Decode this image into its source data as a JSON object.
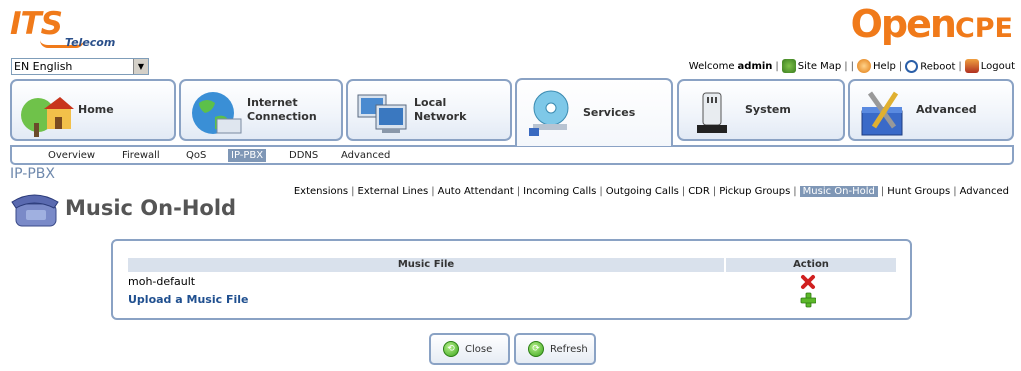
{
  "header": {
    "brand_its": "ITS",
    "brand_telecom": "Telecom",
    "brand_open": "Open",
    "brand_cpe": "CPE"
  },
  "language": {
    "selected": "EN English"
  },
  "top_links": {
    "welcome_prefix": "Welcome",
    "user": "admin",
    "site_map": "Site Map",
    "help": "Help",
    "reboot": "Reboot",
    "logout": "Logout"
  },
  "main_tabs": [
    {
      "label": "Home",
      "icon": "home-icon"
    },
    {
      "label": "Internet\nConnection",
      "icon": "globe-icon"
    },
    {
      "label": "Local\nNetwork",
      "icon": "computers-icon"
    },
    {
      "label": "Services",
      "icon": "services-disc-icon"
    },
    {
      "label": "System",
      "icon": "system-device-icon"
    },
    {
      "label": "Advanced",
      "icon": "tools-icon"
    }
  ],
  "subnav": {
    "items": [
      "Overview",
      "Firewall",
      "QoS",
      "IP-PBX",
      "DDNS",
      "Advanced"
    ],
    "active": "IP-PBX"
  },
  "section_label": "IP-PBX",
  "page_links": {
    "items": [
      "Extensions",
      "External Lines",
      "Auto Attendant",
      "Incoming Calls",
      "Outgoing Calls",
      "CDR",
      "Pickup Groups",
      "Music On-Hold",
      "Hunt Groups",
      "Advanced"
    ],
    "active": "Music On-Hold"
  },
  "page": {
    "title": "Music On-Hold",
    "icon": "phone-icon"
  },
  "table": {
    "col_file": "Music File",
    "col_action": "Action",
    "rows": [
      {
        "file": "moh-default",
        "action_icon": "delete-icon"
      }
    ],
    "upload_link": "Upload a Music File",
    "upload_action_icon": "add-icon"
  },
  "buttons": {
    "close": "Close",
    "refresh": "Refresh"
  },
  "colors": {
    "accent": "#f07a1a",
    "border": "#8aa2c4",
    "active_bg": "#7f97b6",
    "link": "#1f4f8f"
  }
}
